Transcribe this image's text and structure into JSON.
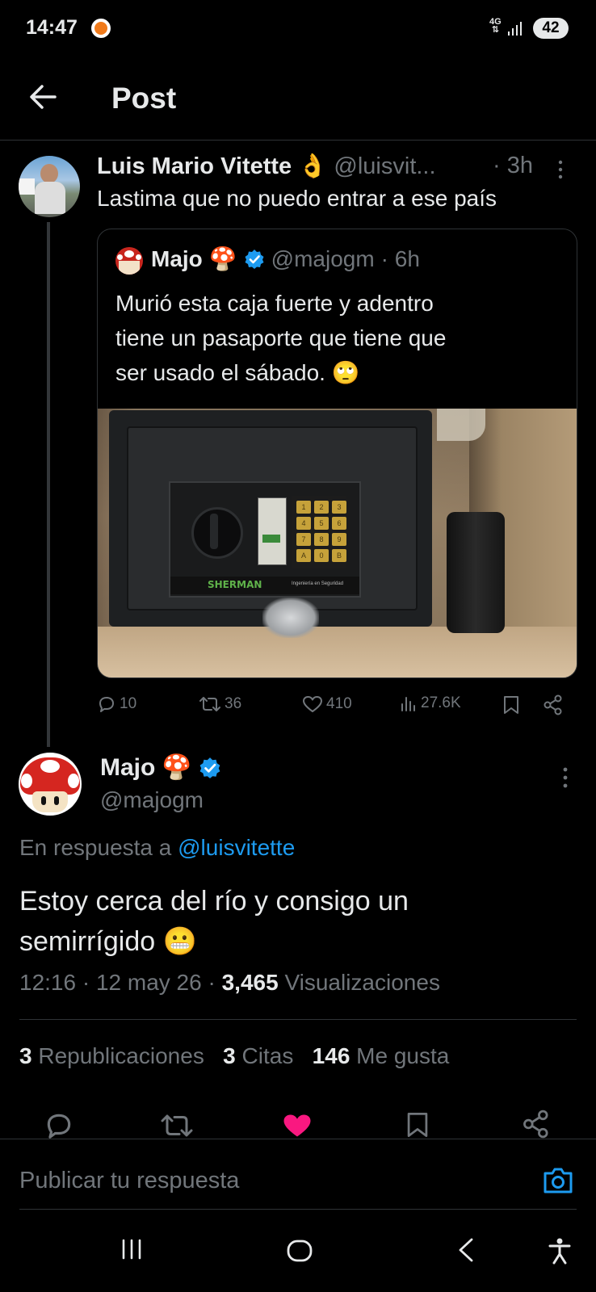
{
  "status_bar": {
    "time": "14:47",
    "network": "4G",
    "battery": "42",
    "notification_icon": "app-notification-icon"
  },
  "header": {
    "title": "Post"
  },
  "parent_post": {
    "author_name": "Luis Mario Vitette",
    "author_emoji": "👌",
    "handle": "@luisvit...",
    "time": "· 3h",
    "text": "Lastima que no puedo entrar a ese país",
    "quoted": {
      "author_name": "Majo",
      "author_emoji": "🍄",
      "handle": "@majogm",
      "time": "· 6h",
      "text_line1": "Murió esta caja fuerte y adentro",
      "text_line2": "tiene un pasaporte que tiene que",
      "text_line3": "ser usado el sábado.",
      "text_emoji": "🙄",
      "image": {
        "brand": "SHERMAN",
        "tagline": "Ingeniería en Seguridad",
        "keypad_keys": [
          "1",
          "2",
          "3",
          "4",
          "5",
          "6",
          "7",
          "8",
          "9",
          "A",
          "0",
          "B"
        ]
      }
    },
    "stats": {
      "replies": "10",
      "reposts": "36",
      "likes": "410",
      "views": "27.6K"
    }
  },
  "main_post": {
    "author_name": "Majo",
    "author_emoji": "🍄",
    "handle": "@majogm",
    "reply_prefix": "En respuesta a",
    "reply_to": "@luisvitette",
    "text_line1": "Estoy cerca del río y consigo un",
    "text_line2": "semirrígido",
    "text_emoji": "😬",
    "time": "12:16 · 12 may 26 ·",
    "views_count": "3,465",
    "views_label": "Visualizaciones",
    "reposts_count": "3",
    "reposts_label": "Republicaciones",
    "quotes_count": "3",
    "quotes_label": "Citas",
    "likes_count": "146",
    "likes_label": "Me gusta"
  },
  "reply_bar": {
    "placeholder": "Publicar tu respuesta"
  },
  "colors": {
    "accent": "#1d9bf0",
    "like": "#f91880",
    "muted": "#71767b",
    "background": "#000000"
  }
}
